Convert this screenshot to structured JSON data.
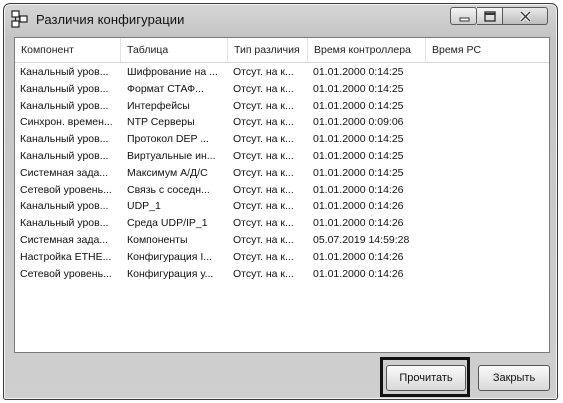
{
  "window": {
    "title": "Различия конфигурации"
  },
  "table": {
    "columns": [
      "Компонент",
      "Таблица",
      "Тип различия",
      "Время контроллера",
      "Время PC"
    ],
    "rows": [
      [
        "Канальный уров...",
        "Шифрование на ...",
        "Отсут. на к...",
        "01.01.2000 0:14:25",
        ""
      ],
      [
        "Канальный уров...",
        "Формат СТАФ...",
        "Отсут. на к...",
        "01.01.2000 0:14:25",
        ""
      ],
      [
        "Канальный уров...",
        "Интерфейсы",
        "Отсут. на к...",
        "01.01.2000 0:14:25",
        ""
      ],
      [
        "Синхрон. времен...",
        "NTP Серверы",
        "Отсут. на к...",
        "01.01.2000 0:09:06",
        ""
      ],
      [
        "Канальный уров...",
        "Протокол DEP ...",
        "Отсут. на к...",
        "01.01.2000 0:14:25",
        ""
      ],
      [
        "Канальный уров...",
        "Виртуальные ин...",
        "Отсут. на к...",
        "01.01.2000 0:14:25",
        ""
      ],
      [
        "Системная зада...",
        "Максимум А/Д/С",
        "Отсут. на к...",
        "01.01.2000 0:14:25",
        ""
      ],
      [
        "Сетевой уровень...",
        "Связь с соседн...",
        "Отсут. на к...",
        "01.01.2000 0:14:26",
        ""
      ],
      [
        "Канальный уров...",
        "UDP_1",
        "Отсут. на к...",
        "01.01.2000 0:14:26",
        ""
      ],
      [
        "Канальный уров...",
        "Среда UDP/IP_1",
        "Отсут. на к...",
        "01.01.2000 0:14:26",
        ""
      ],
      [
        "Системная зада...",
        "Компоненты",
        "Отсут. на к...",
        "05.07.2019 14:59:28",
        ""
      ],
      [
        "Настройка ETHE...",
        "Конфигурация I...",
        "Отсут. на к...",
        "01.01.2000 0:14:26",
        ""
      ],
      [
        "Сетевой уровень...",
        "Конфигурация у...",
        "Отсут. на к...",
        "01.01.2000 0:14:26",
        ""
      ]
    ]
  },
  "buttons": {
    "read_label": "Прочитать",
    "close_label": "Закрыть"
  },
  "icons": {
    "app": "network-config-icon",
    "minimize": "minimize-icon",
    "maximize": "maximize-icon",
    "close": "close-icon"
  }
}
